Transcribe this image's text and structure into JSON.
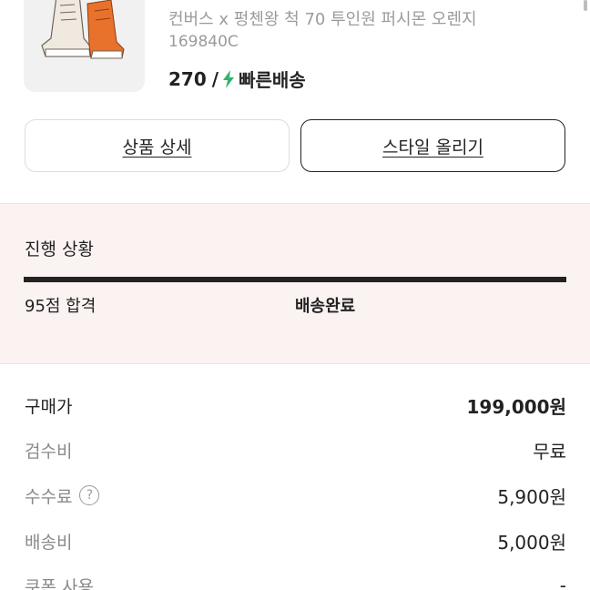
{
  "product": {
    "name": "컨버스 x 펑첸왕 척 70 투인원 퍼시몬 오렌지",
    "code": "169840C",
    "size": "270",
    "separator": "/",
    "shipping_label": "빠른배송"
  },
  "buttons": {
    "detail_label": "상품 상세",
    "style_label": "스타일 올리기"
  },
  "progress": {
    "title": "진행 상황",
    "step1": "95점 합격",
    "step2": "배송완료",
    "fill": 1.0
  },
  "prices": {
    "purchase": {
      "label": "구매가",
      "value": "199,000원"
    },
    "inspection": {
      "label": "검수비",
      "value": "무료"
    },
    "fee": {
      "label": "수수료",
      "value": "5,900원",
      "help_icon": "question-circle-icon"
    },
    "shipping": {
      "label": "배송비",
      "value": "5,000원"
    },
    "coupon": {
      "label": "쿠폰 사용",
      "value": "-"
    }
  },
  "colors": {
    "accent_bolt": "#31b46e",
    "progress_bg": "#fbf3f2"
  }
}
